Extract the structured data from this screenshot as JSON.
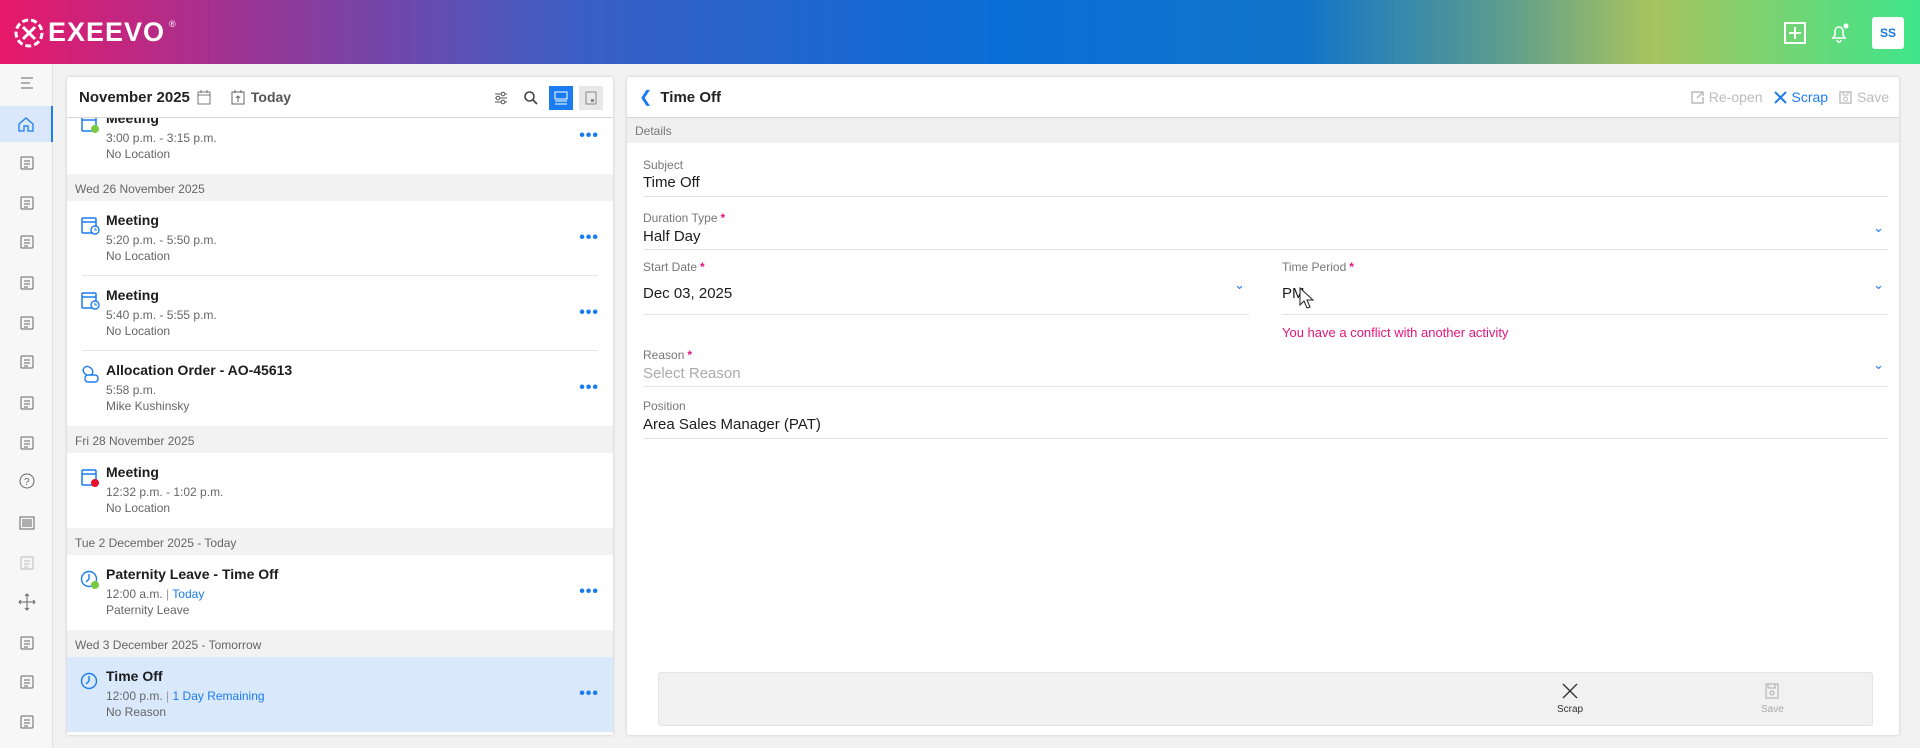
{
  "brand": {
    "name": "EXEEVO",
    "reg": "®"
  },
  "header": {
    "user_initials": "SS"
  },
  "sidebar": {
    "items": [
      "menu-icon",
      "home-icon",
      "folder-settings-icon",
      "folder-icon",
      "pie-chart-icon",
      "document-check-icon",
      "presentation-icon",
      "report-icon",
      "contact-card-icon",
      "pills-icon",
      "help-icon",
      "barcode-icon",
      "map-icon",
      "move-icon",
      "chart-icon",
      "receipt-icon",
      "briefcase-icon"
    ]
  },
  "calendar": {
    "title": "November 2025",
    "today_label": "Today",
    "groups": [
      {
        "header": null,
        "items": [
          {
            "title": "Meeting",
            "time": "3:00 p.m. - 3:15 p.m.",
            "sub": "No Location",
            "icon": "meeting-icon",
            "dot": "#7ac943"
          }
        ]
      },
      {
        "header": "Wed 26 November 2025",
        "items": [
          {
            "title": "Meeting",
            "time": "5:20 p.m. - 5:50 p.m.",
            "sub": "No Location",
            "icon": "meeting-clock-icon"
          },
          {
            "title": "Meeting",
            "time": "5:40 p.m. - 5:55 p.m.",
            "sub": "No Location",
            "icon": "meeting-clock-icon"
          },
          {
            "title": "Allocation Order - AO-45613",
            "time": "5:58 p.m.",
            "sub": "Mike Kushinsky",
            "icon": "allocation-icon"
          }
        ]
      },
      {
        "header": "Fri 28 November 2025",
        "items": [
          {
            "title": "Meeting",
            "time": "12:32 p.m. - 1:02 p.m.",
            "sub": "No Location",
            "icon": "meeting-icon",
            "dot": "#e8102e",
            "no_more": true
          }
        ]
      },
      {
        "header": "Tue 2 December 2025 - Today",
        "items": [
          {
            "title": "Paternity Leave - Time Off",
            "time": "12:00 a.m.",
            "tag": "Today",
            "sub": "Paternity Leave",
            "icon": "time-off-icon",
            "dot": "#7ac943"
          }
        ]
      },
      {
        "header": "Wed 3 December 2025 - Tomorrow",
        "items": [
          {
            "title": "Time Off",
            "time": "12:00 p.m.",
            "tag": "1 Day Remaining",
            "sub": "No Reason",
            "icon": "time-off-icon",
            "selected": true
          }
        ]
      }
    ]
  },
  "detail": {
    "title": "Time Off",
    "reopen": "Re-open",
    "scrap": "Scrap",
    "save": "Save",
    "section": "Details",
    "subject_label": "Subject",
    "subject": "Time Off",
    "duration_label": "Duration Type",
    "duration": "Half Day",
    "start_label": "Start Date",
    "start": "Dec 03, 2025",
    "period_label": "Time Period",
    "period": "PM",
    "error": "You have a conflict with another activity",
    "reason_label": "Reason",
    "reason_placeholder": "Select Reason",
    "position_label": "Position",
    "position": "Area Sales Manager (PAT)"
  },
  "colors": {
    "accent": "#1a7cf0",
    "error": "#e3157a"
  }
}
